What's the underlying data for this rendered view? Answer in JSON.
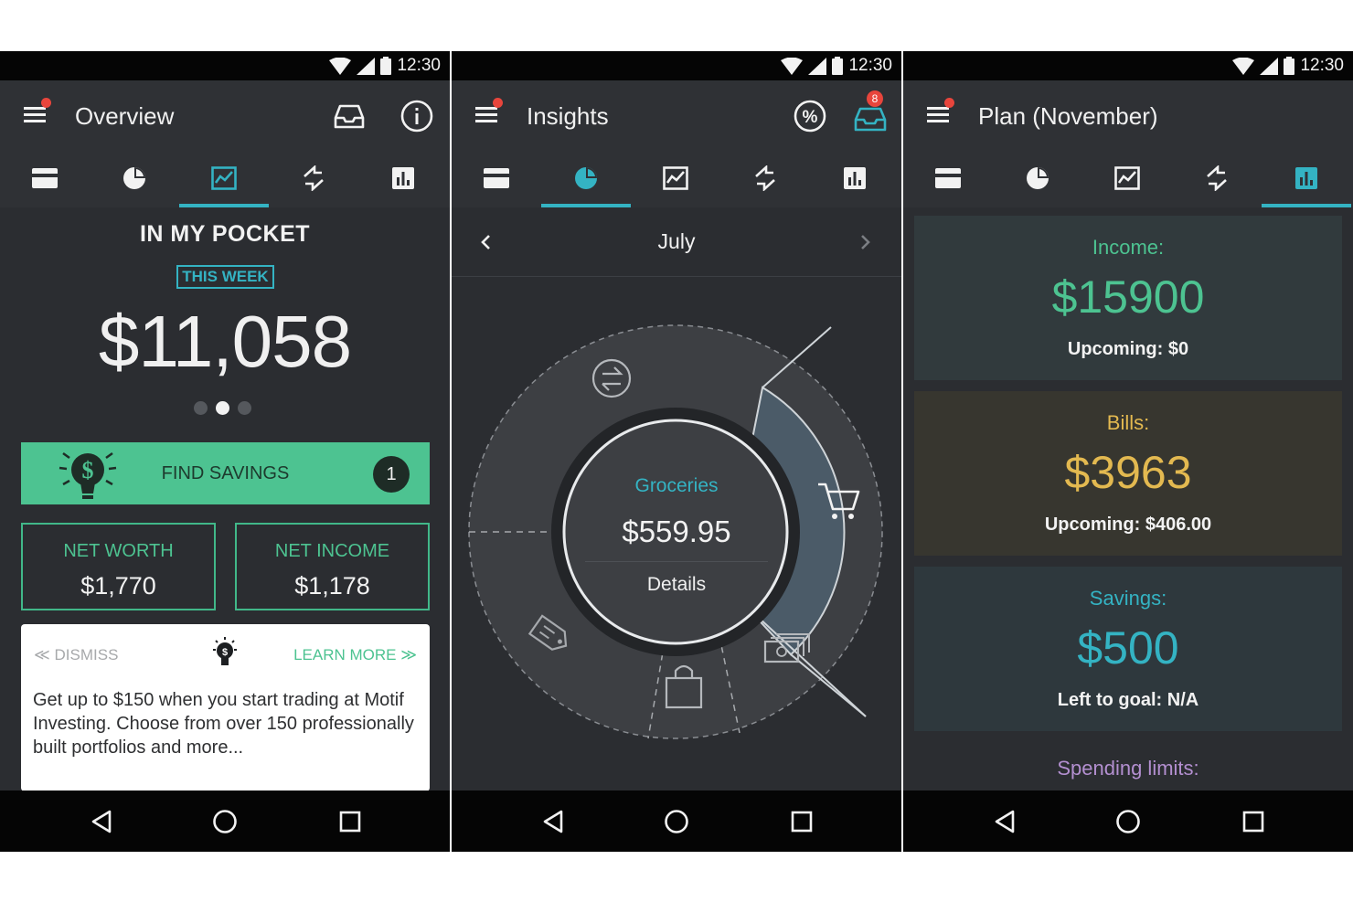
{
  "status": {
    "time": "12:30"
  },
  "colors": {
    "accent": "#34b3c3",
    "green": "#4dc391",
    "gold": "#e3b950",
    "purple": "#b38fd0",
    "alert": "#e8453c"
  },
  "overview": {
    "title": "Overview",
    "section_title": "IN MY POCKET",
    "period_badge": "THIS WEEK",
    "amount": "$11,058",
    "find_savings": {
      "label": "FIND SAVINGS",
      "count": "1"
    },
    "net_worth": {
      "label": "NET WORTH",
      "value": "$1,770"
    },
    "net_income": {
      "label": "NET INCOME",
      "value": "$1,178"
    },
    "promo": {
      "dismiss": "≪ DISMISS",
      "learn_more": "LEARN MORE ≫",
      "text": "Get up to $150 when you start trading at Motif Investing. Choose from over 150 professionally built portfolios and more..."
    }
  },
  "insights": {
    "title": "Insights",
    "inbox_badge": "8",
    "month": "July",
    "category": "Groceries",
    "amount": "$559.95",
    "details": "Details"
  },
  "plan": {
    "title": "Plan (November)",
    "income": {
      "label": "Income:",
      "amount": "$15900",
      "sub": "Upcoming: $0"
    },
    "bills": {
      "label": "Bills:",
      "amount": "$3963",
      "sub": "Upcoming: $406.00"
    },
    "savings": {
      "label": "Savings:",
      "amount": "$500",
      "sub": "Left to goal: N/A"
    },
    "limits_label": "Spending limits:"
  },
  "icons": {
    "tabs": [
      "card-icon",
      "pie-chart-icon",
      "trend-chart-icon",
      "transfer-icon",
      "bar-chart-icon"
    ],
    "nav": [
      "back-icon",
      "home-icon",
      "recents-icon"
    ]
  }
}
